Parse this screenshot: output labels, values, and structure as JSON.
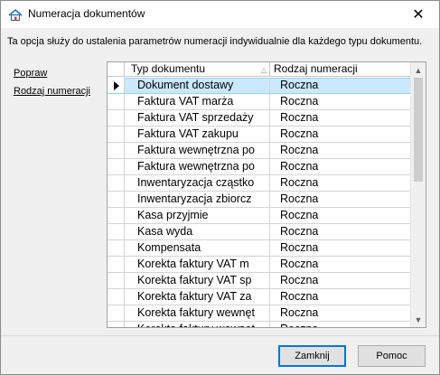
{
  "window": {
    "title": "Numeracja dokumentów",
    "close_glyph": "✕",
    "app_icon": "app-icon"
  },
  "description": "Ta opcja służy do ustalenia parametrów numeracji indywidualnie dla każdego typu dokumentu.",
  "links": {
    "popraw": "Popraw",
    "rodzaj": "Rodzaj numeracji"
  },
  "grid": {
    "columns": [
      "Typ dokumentu",
      "Rodzaj numeracji"
    ],
    "rows": [
      {
        "typ": "Dokument dostawy",
        "rodzaj": "Roczna"
      },
      {
        "typ": "Faktura VAT marża",
        "rodzaj": "Roczna"
      },
      {
        "typ": "Faktura VAT sprzedaży",
        "rodzaj": "Roczna"
      },
      {
        "typ": "Faktura VAT zakupu",
        "rodzaj": "Roczna"
      },
      {
        "typ": "Faktura wewnętrzna po",
        "rodzaj": "Roczna"
      },
      {
        "typ": "Faktura wewnętrzna po",
        "rodzaj": "Roczna"
      },
      {
        "typ": "Inwentaryzacja cząstko",
        "rodzaj": "Roczna"
      },
      {
        "typ": "Inwentaryzacja zbiorcz",
        "rodzaj": "Roczna"
      },
      {
        "typ": "Kasa przyjmie",
        "rodzaj": "Roczna"
      },
      {
        "typ": "Kasa wyda",
        "rodzaj": "Roczna"
      },
      {
        "typ": "Kompensata",
        "rodzaj": "Roczna"
      },
      {
        "typ": "Korekta faktury VAT m",
        "rodzaj": "Roczna"
      },
      {
        "typ": "Korekta faktury VAT sp",
        "rodzaj": "Roczna"
      },
      {
        "typ": "Korekta faktury VAT za",
        "rodzaj": "Roczna"
      },
      {
        "typ": "Korekta faktury wewnęt",
        "rodzaj": "Roczna"
      },
      {
        "typ": "Korekta faktury wewnęt",
        "rodzaj": "Roczna"
      }
    ],
    "selected_row": 0,
    "sort_glyph": "△"
  },
  "buttons": {
    "zamknij": "Zamknij",
    "pomoc": "Pomoc"
  },
  "colors": {
    "selection": "#cce8ff",
    "default_button_border": "#0078d7"
  }
}
